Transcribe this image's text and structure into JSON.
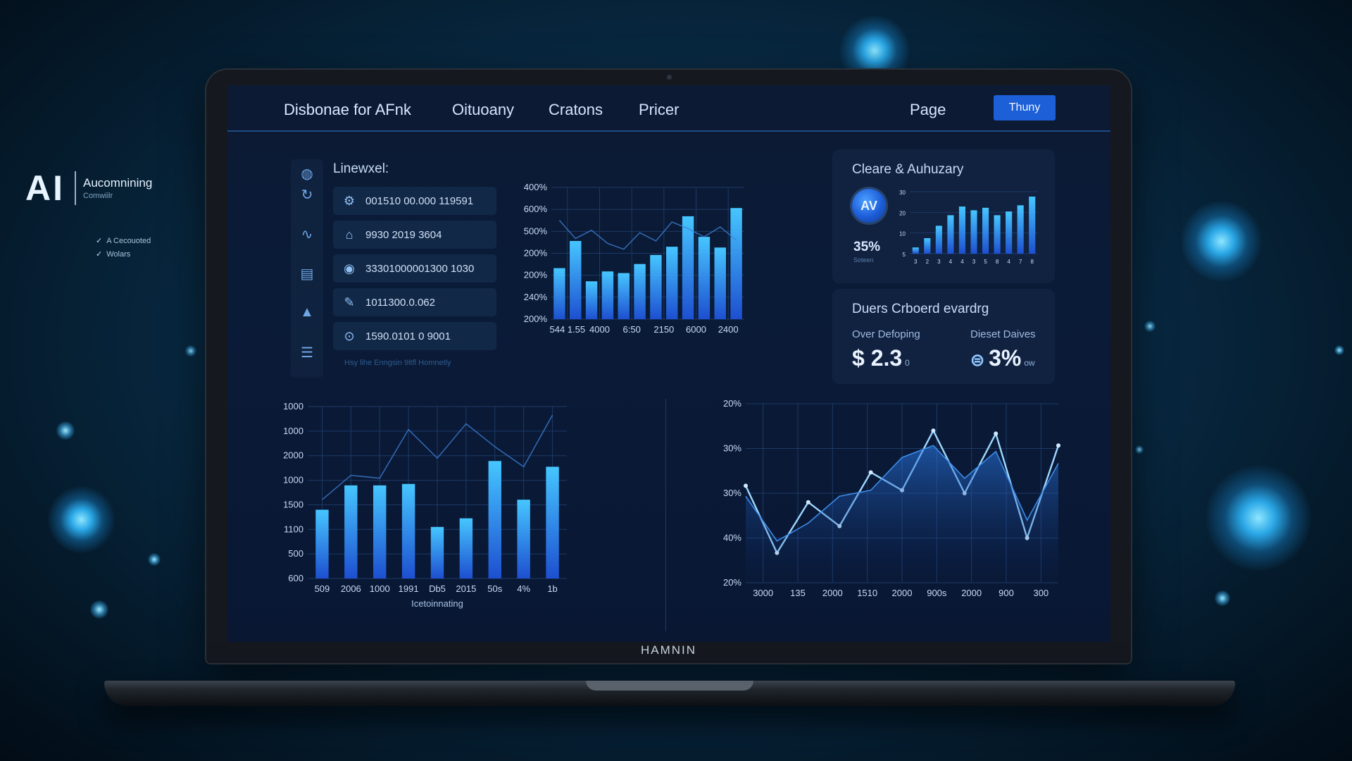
{
  "brand": {
    "logo": "AI",
    "name": "Aucomnining",
    "sub": "Comwiilr"
  },
  "checklist": [
    "A Cecouoted",
    "Wolars"
  ],
  "nav": {
    "title": "Disbonae for AFnk",
    "items": [
      "Oituoany",
      "Cratons",
      "Pricer",
      "Page"
    ],
    "button": "Thuny"
  },
  "side_icons": [
    "globe-icon",
    "refresh-icon",
    "wave-icon",
    "document-icon",
    "rocket-icon",
    "database-icon"
  ],
  "list": {
    "heading": "Linewxel:",
    "rows": [
      {
        "icon": "network-icon",
        "text": "001510 00.000 119591"
      },
      {
        "icon": "home-icon",
        "text": "9930 2019 3604"
      },
      {
        "icon": "target-icon",
        "text": "33301000001300 1030"
      },
      {
        "icon": "pen-icon",
        "text": "1011300.0.062"
      },
      {
        "icon": "pin-icon",
        "text": "1590.0101 0 9001"
      }
    ],
    "caption": "Hsy lihe Enngsin 9ltfl Homnetly"
  },
  "card1": {
    "title": "Cleare & Auhuzary",
    "badge": "AV",
    "percent": "35%",
    "percent_sub": "Soteen"
  },
  "card2": {
    "title": "Duers Crboerd evardrg",
    "kpi1_label": "Over Defoping",
    "kpi1_value": "$ 2.3",
    "kpi1_suffix": "0",
    "kpi2_label": "Dieset Daives",
    "kpi2_value": "3%",
    "kpi2_suffix": "ow"
  },
  "colors": {
    "accent": "#1c5fd6",
    "bar": "#2c82f0",
    "bar_top": "#46c6ff",
    "grid": "#1d3a66"
  },
  "model_name": "HAMNIN",
  "chart_data": [
    {
      "id": "top-chart",
      "type": "bar",
      "y_ticks": [
        "400%",
        "600%",
        "500%",
        "200%",
        "200%",
        "240%",
        "200%"
      ],
      "x_ticks": [
        "544 1.55",
        "4000",
        "6:50",
        "2150",
        "6000",
        "2400"
      ],
      "values": [
        62,
        95,
        46,
        58,
        56,
        67,
        78,
        88,
        125,
        100,
        87,
        135
      ],
      "line": [
        120,
        98,
        108,
        92,
        85,
        105,
        95,
        118,
        110,
        100,
        112,
        96
      ],
      "ylim": [
        0,
        160
      ]
    },
    {
      "id": "mini-chart",
      "type": "bar",
      "y_ticks": [
        "30",
        "20",
        "10",
        "5"
      ],
      "x_ticks": [
        "3",
        "2",
        "3",
        "4",
        "4",
        "3",
        "5",
        "8",
        "4",
        "7",
        "8"
      ],
      "values": [
        10,
        25,
        45,
        62,
        76,
        70,
        74,
        62,
        68,
        78,
        92
      ],
      "ylim": [
        0,
        100
      ]
    },
    {
      "id": "bottom-left-chart",
      "type": "bar",
      "y_ticks": [
        "1000",
        "1000",
        "2000",
        "1000",
        "1500",
        "1100",
        "500",
        "600"
      ],
      "x_ticks": [
        "509",
        "2006",
        "1000",
        "1991",
        "Db5",
        "2015",
        "50s",
        "4%",
        "1b"
      ],
      "xlabel": "Icetoinnating",
      "values": [
        48,
        65,
        65,
        66,
        36,
        42,
        82,
        55,
        78
      ],
      "line": [
        55,
        72,
        70,
        104,
        84,
        108,
        92,
        78,
        114
      ],
      "ylim": [
        0,
        120
      ]
    },
    {
      "id": "bottom-right-chart",
      "type": "line",
      "y_ticks": [
        "20%",
        "30%",
        "30%",
        "40%",
        "20%"
      ],
      "x_ticks": [
        "3000",
        "135",
        "2000",
        "1510",
        "2000",
        "900s",
        "2000",
        "900",
        "300"
      ],
      "series": [
        {
          "values": [
            65,
            20,
            54,
            38,
            74,
            62,
            102,
            60,
            100,
            30,
            92
          ]
        },
        {
          "values": [
            58,
            28,
            40,
            58,
            62,
            84,
            92,
            70,
            88,
            42,
            80
          ]
        }
      ],
      "ylim": [
        0,
        120
      ]
    }
  ]
}
